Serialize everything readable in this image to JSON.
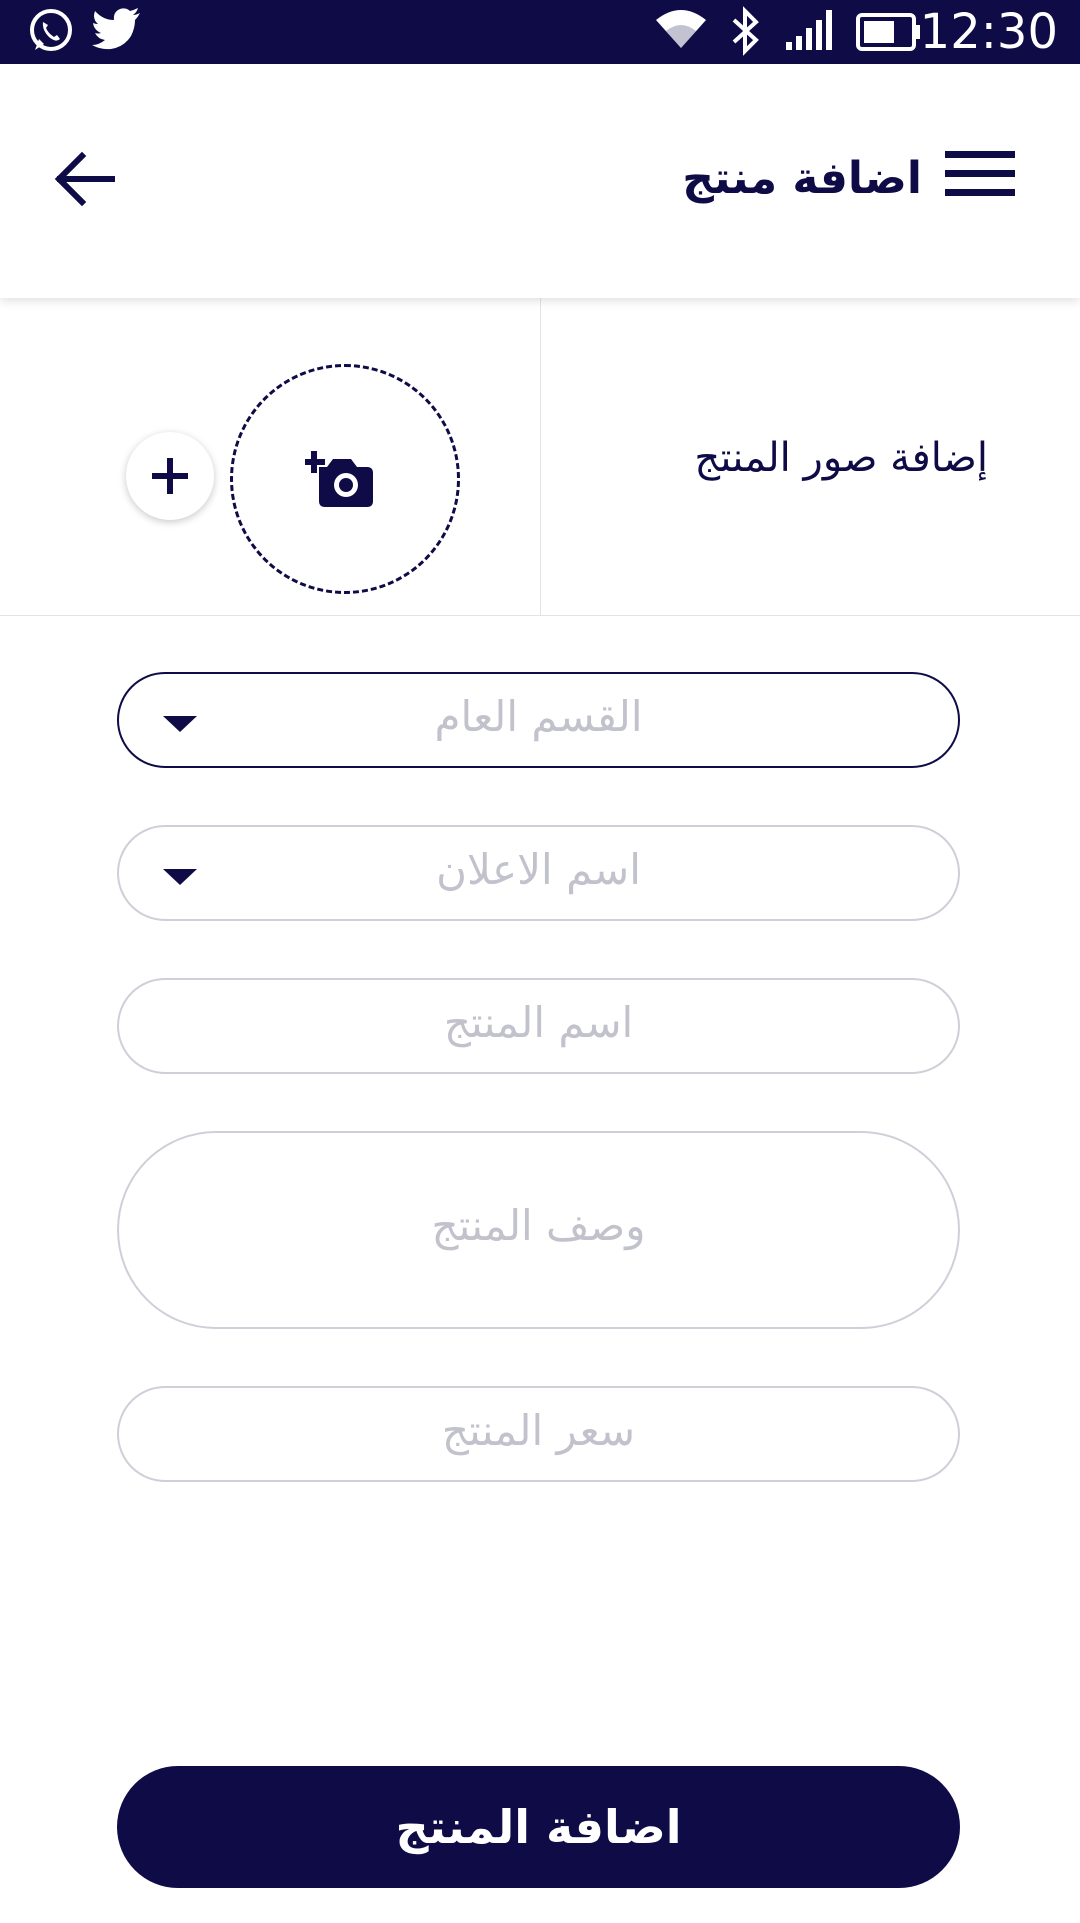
{
  "status_bar": {
    "time": "12:30",
    "left_icons": [
      "whatsapp-icon",
      "twitter-icon"
    ],
    "right_icons": [
      "wifi-icon",
      "bluetooth-icon",
      "signal-icon",
      "battery-icon"
    ]
  },
  "app_bar": {
    "title": "اضافة منتج",
    "menu_icon": "hamburger-menu-icon",
    "back_icon": "arrow-left-icon"
  },
  "photos": {
    "label": "إضافة صور المنتج",
    "camera_icon": "add-a-photo-icon",
    "add_icon": "plus-icon"
  },
  "form": {
    "category_placeholder": "القسم العام",
    "ad_name_placeholder": "اسم الاعلان",
    "product_name_placeholder": "اسم المنتج",
    "description_placeholder": "وصف المنتج",
    "price_placeholder": "سعر المنتج"
  },
  "submit_label": "اضافة المنتج",
  "colors": {
    "primary": "#0e0b47",
    "border": "#cfcfd9",
    "placeholder": "#c2c2cc",
    "background": "#ffffff"
  }
}
